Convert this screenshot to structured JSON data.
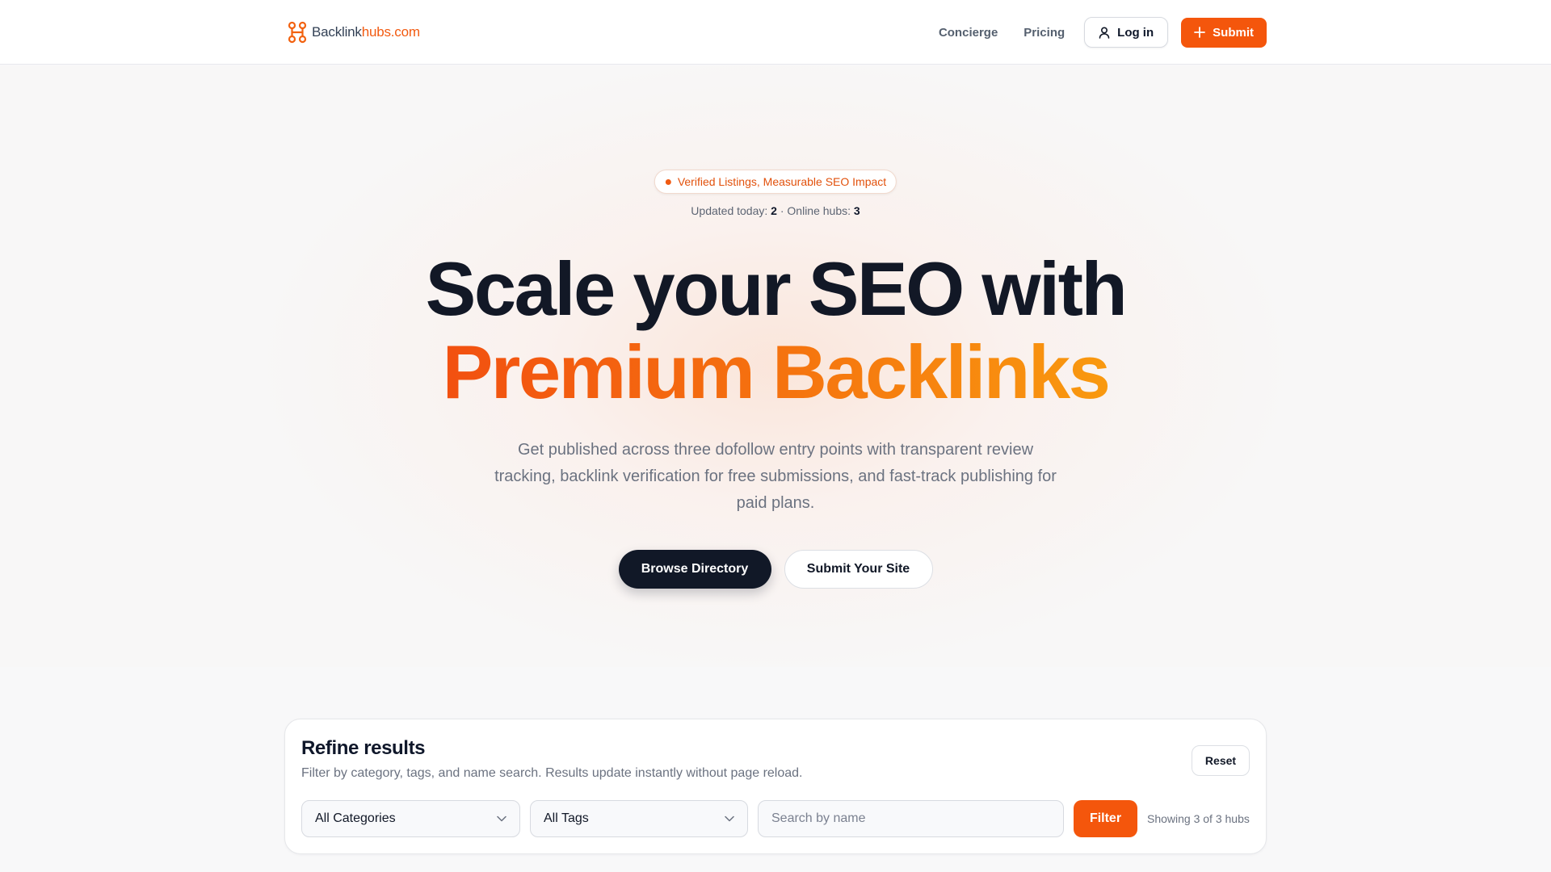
{
  "header": {
    "logo": {
      "part1": "Backlink",
      "part2": "hubs.com",
      "icon": "link-mark-icon"
    },
    "nav": {
      "concierge": "Concierge",
      "pricing": "Pricing"
    },
    "login_label": "Log in",
    "submit_label": "Submit",
    "login_icon": "user-icon",
    "submit_icon": "plus-icon"
  },
  "hero": {
    "badge": "Verified Listings, Measurable SEO Impact",
    "stats": {
      "updated_label": "Updated today:",
      "updated_value": "2",
      "separator": "·",
      "online_label": "Online hubs:",
      "online_value": "3"
    },
    "title_line1": "Scale your SEO with",
    "title_line2": "Premium Backlinks",
    "lead": "Get published across three dofollow entry points with transparent review tracking, backlink verification for free submissions, and fast-track publishing for paid plans.",
    "browse_label": "Browse Directory",
    "submit_site_label": "Submit Your Site"
  },
  "filters": {
    "title": "Refine results",
    "subtitle": "Filter by category, tags, and name search. Results update instantly without page reload.",
    "reset_label": "Reset",
    "category_selected": "All Categories",
    "tags_selected": "All Tags",
    "search_placeholder": "Search by name",
    "search_value": "",
    "filter_label": "Filter",
    "showing": "Showing 3 of 3 hubs"
  },
  "colors": {
    "accent": "#f4560c",
    "dark": "#111827",
    "gradient_start": "#f25010",
    "gradient_end": "#f9990f"
  }
}
